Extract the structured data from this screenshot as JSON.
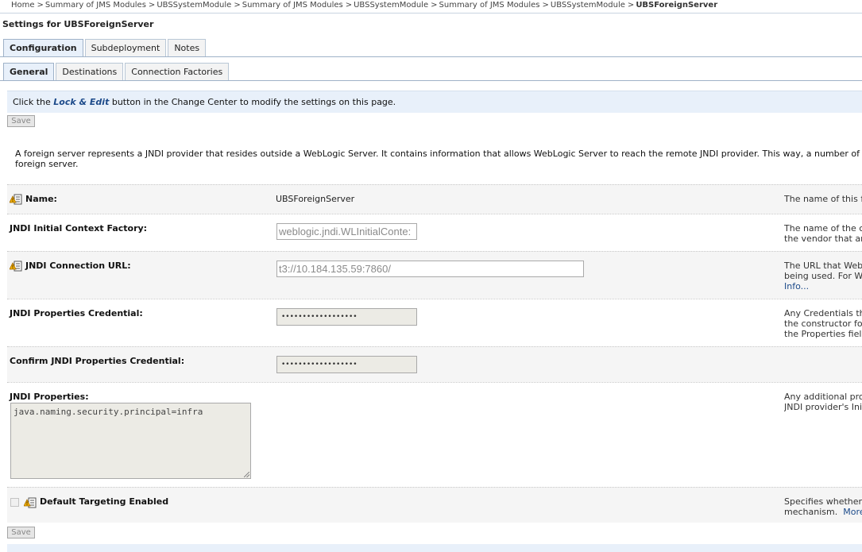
{
  "breadcrumb": {
    "items": [
      "Home",
      "Summary of JMS Modules",
      "UBSSystemModule",
      "Summary of JMS Modules",
      "UBSSystemModule",
      "Summary of JMS Modules",
      "UBSSystemModule"
    ],
    "current": "UBSForeignServer",
    "separator": ">"
  },
  "page": {
    "title": "Settings for UBSForeignServer"
  },
  "tabs": {
    "configuration": "Configuration",
    "subdeployment": "Subdeployment",
    "notes": "Notes"
  },
  "subtabs": {
    "general": "General",
    "destinations": "Destinations",
    "connection_factories": "Connection Factories"
  },
  "info": {
    "prefix": "Click the",
    "lock_edit": "Lock & Edit",
    "suffix": "button in the Change Center to modify the settings on this page."
  },
  "buttons": {
    "save": "Save"
  },
  "description": {
    "line1": "A foreign server represents a JNDI provider that resides outside a WebLogic Server. It contains information that allows WebLogic Server to reach the remote JNDI provider. This way, a number of connection factory and",
    "line2": "foreign server."
  },
  "fields": {
    "name": {
      "label": "Name:",
      "value": "UBSForeignServer",
      "hint1": "The name of this for"
    },
    "context_factory": {
      "label": "JNDI Initial Context Factory:",
      "value": "weblogic.jndi.WLInitialConte:",
      "hint1": "The name of the cla",
      "hint2": "the vendor that are"
    },
    "connection_url": {
      "label": "JNDI Connection URL:",
      "value": "t3://10.184.135.59:7860/",
      "hint1": "The URL that WebLo",
      "hint2": "being used. For Web",
      "hint3": "Info..."
    },
    "credential": {
      "label": "JNDI Properties Credential:",
      "value": "••••••••••••••••••",
      "hint1": "Any Credentials that",
      "hint2": "the constructor for t",
      "hint3": "the Properties field r"
    },
    "confirm_credential": {
      "label": "Confirm JNDI Properties Credential:",
      "value": "••••••••••••••••••"
    },
    "properties": {
      "label": "JNDI Properties:",
      "value": "java.naming.security.principal=infra",
      "hint1": "Any additional prope",
      "hint2": "JNDI provider's Initia"
    },
    "default_targeting": {
      "label": "Default Targeting Enabled",
      "checked": false,
      "hint1": "Specifies whether th",
      "hint2": "mechanism.",
      "more": "More"
    }
  },
  "colors": {
    "accent": "#1c4a8a",
    "info_bg": "#e8f0fa",
    "row_shade": "#f5f5f5"
  },
  "icons": {
    "change_requires_restart": "lock-restart-icon"
  }
}
